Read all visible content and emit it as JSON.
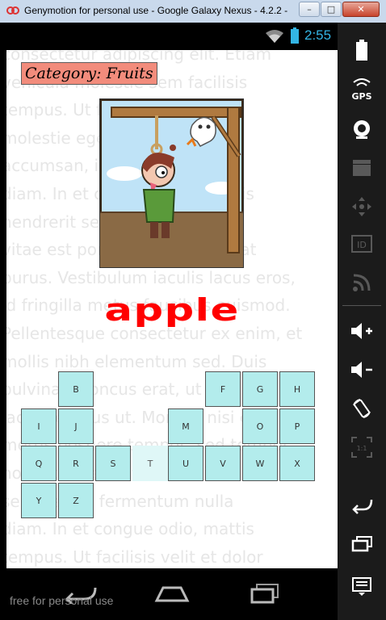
{
  "window": {
    "title": "Genymotion for personal use - Google Galaxy Nexus - 4.2.2 - ",
    "min_symbol": "–",
    "max_symbol": "□",
    "close_symbol": "✕"
  },
  "statusbar": {
    "time": "2:55",
    "accent_color": "#33b5e5"
  },
  "game": {
    "category": "Category: Fruits",
    "word": "apple",
    "word_color": "#ff0000",
    "background_text": "consectetur adipiscing elit. Etiam\nvehicula molestie sem facilisis\ntempus. Ut facilisis et dolor\nmolestie egestas. Sed lectus\naccumsan, id scelerisque\ndiam. In et congue odio, mattis\nhendrerit sem. Sed vel odio\nvitae est porta fermentum in at\npurus. Vestibulum iaculis lacus eros,\nid fringilla metus faucibus euismod.\nPellentesque consectetur ex enim, et\nmollis nibh elementum sed. Duis\npulvinar rhoncus erat, ut faucibus\nlacus tempus ut. Morbi a nisi eget\nmetus posuere tempor, sed tempor\nnon vitae sed. Etiam vehicula\nsem vel vel fermentum nulla\ndiam. In et congue odio, mattis\ntempus. Ut facilisis velit et dolor",
    "keys": {
      "B": "B",
      "F": "F",
      "G": "G",
      "H": "H",
      "I": "I",
      "J": "J",
      "M": "M",
      "O": "O",
      "P": "P",
      "Q": "Q",
      "R": "R",
      "S": "S",
      "T": "T",
      "U": "U",
      "V": "V",
      "W": "W",
      "X": "X",
      "Y": "Y",
      "Z": "Z"
    }
  },
  "watermark": "free for personal use",
  "toolbar": {
    "battery_icon": "battery-icon",
    "gps_label": "GPS",
    "id_label": "ID",
    "pixel_label": "1:1"
  }
}
